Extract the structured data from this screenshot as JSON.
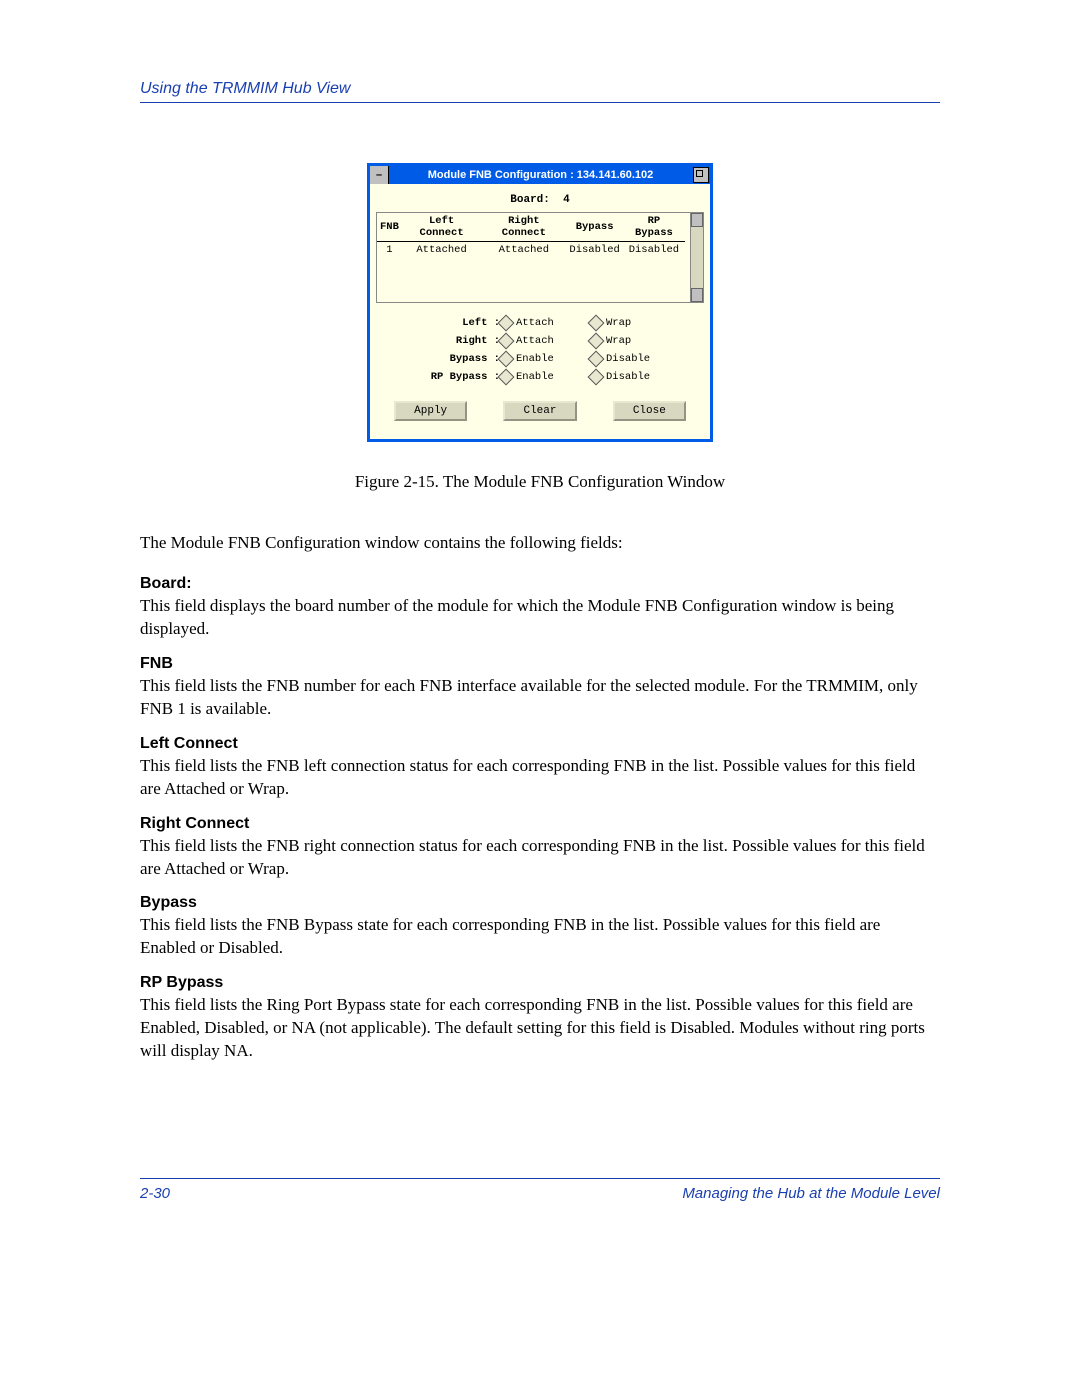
{
  "header": {
    "running": "Using the TRMMIM Hub View"
  },
  "window": {
    "title": "Module FNB Configuration : 134.141.60.102",
    "board_label": "Board:",
    "board_value": "4",
    "columns": {
      "c1": "FNB",
      "c2": "Left Connect",
      "c3": "Right Connect",
      "c4": "Bypass",
      "c5": "RP Bypass"
    },
    "row": {
      "fnb": "1",
      "left": "Attached",
      "right": "Attached",
      "bypass": "Disabled",
      "rp": "Disabled"
    },
    "opts": {
      "left_label": "Left :",
      "left_a": "Attach",
      "left_b": "Wrap",
      "right_label": "Right :",
      "right_a": "Attach",
      "right_b": "Wrap",
      "bypass_label": "Bypass :",
      "bypass_a": "Enable",
      "bypass_b": "Disable",
      "rp_label": "RP Bypass :",
      "rp_a": "Enable",
      "rp_b": "Disable"
    },
    "buttons": {
      "apply": "Apply",
      "clear": "Clear",
      "close": "Close"
    }
  },
  "caption": "Figure 2-15. The Module FNB Configuration Window",
  "intro": "The Module FNB Configuration window contains the following fields:",
  "fields": {
    "board_h": "Board:",
    "board_p": "This field displays the board number of the module for which the Module FNB Configuration window is being displayed.",
    "fnb_h": "FNB",
    "fnb_p": "This field lists the FNB number for each FNB interface available for the selected module. For the TRMMIM, only FNB 1 is available.",
    "left_h": "Left Connect",
    "left_p": "This field lists the FNB left connection status for each corresponding FNB in the list. Possible values for this field are Attached or Wrap.",
    "right_h": "Right Connect",
    "right_p": "This field lists the FNB right connection status for each corresponding FNB in the list. Possible values for this field are Attached or Wrap.",
    "bypass_h": "Bypass",
    "bypass_p": "This field lists the FNB Bypass state for each corresponding FNB in the list. Possible values for this field are Enabled or Disabled.",
    "rp_h": "RP Bypass",
    "rp_p": "This field lists the Ring Port Bypass state for each corresponding FNB in the list. Possible values for this field are Enabled, Disabled, or NA (not applicable). The default setting for this field is Disabled. Modules without ring ports will display NA."
  },
  "footer": {
    "pageno": "2-30",
    "section": "Managing the Hub at the Module Level"
  }
}
